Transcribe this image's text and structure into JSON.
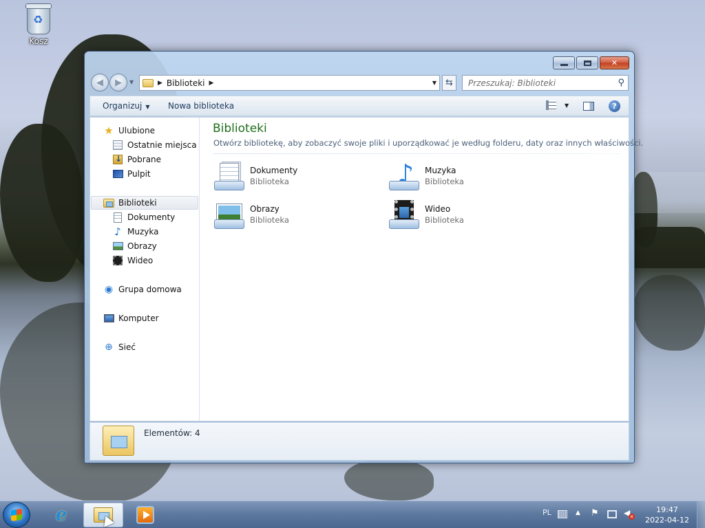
{
  "desktop": {
    "recycle_bin_label": "Kosz"
  },
  "window": {
    "address": {
      "crumb": "Biblioteki"
    },
    "search": {
      "placeholder": "Przeszukaj: Biblioteki"
    },
    "toolbar": {
      "organize_label": "Organizuj",
      "new_library_label": "Nowa biblioteka"
    },
    "nav": {
      "favorites": "Ulubione",
      "recent": "Ostatnie miejsca",
      "downloads": "Pobrane",
      "desktop": "Pulpit",
      "libraries": "Biblioteki",
      "documents": "Dokumenty",
      "music": "Muzyka",
      "pictures": "Obrazy",
      "videos": "Wideo",
      "homegroup": "Grupa domowa",
      "computer": "Komputer",
      "network": "Sieć"
    },
    "main": {
      "title": "Biblioteki",
      "description": "Otwórz bibliotekę, aby zobaczyć swoje pliki i uporządkować je według folderu, daty oraz innych właściwości.",
      "libraries": [
        {
          "name": "Dokumenty",
          "type": "Biblioteka",
          "icon": "documents-library-icon"
        },
        {
          "name": "Muzyka",
          "type": "Biblioteka",
          "icon": "music-library-icon"
        },
        {
          "name": "Obrazy",
          "type": "Biblioteka",
          "icon": "pictures-library-icon"
        },
        {
          "name": "Wideo",
          "type": "Biblioteka",
          "icon": "videos-library-icon"
        }
      ]
    },
    "details": {
      "count_text": "Elementów: 4"
    }
  },
  "taskbar": {
    "language": "PL",
    "time": "19:47",
    "date": "2022-04-12"
  }
}
